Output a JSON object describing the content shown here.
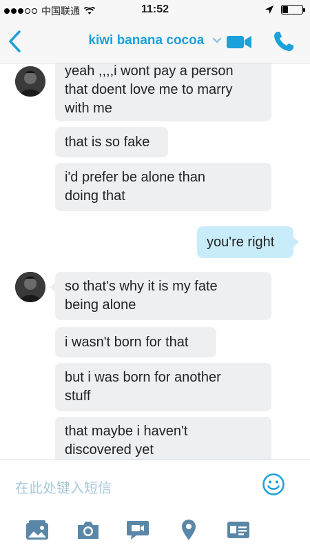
{
  "status": {
    "carrier": "中国联通",
    "time": "11:52",
    "battery_level": 0.3
  },
  "nav": {
    "contact_name": "kiwi banana cocoa",
    "icons": [
      "back-chevron-icon",
      "dropdown-chevron-icon",
      "video-call-icon",
      "phone-call-icon"
    ]
  },
  "messages": [
    {
      "direction": "in",
      "text_lines": [
        "yeah ,,,,i wont pay a person",
        "that doent love me to marry",
        "with me"
      ]
    },
    {
      "direction": "in",
      "text_lines": [
        "that is so fake"
      ]
    },
    {
      "direction": "in",
      "text_lines": [
        "i'd prefer be alone than",
        "doing that"
      ]
    },
    {
      "direction": "out",
      "text_lines": [
        "you're right"
      ]
    },
    {
      "direction": "in",
      "text_lines": [
        "so that's why it is my fate",
        "being alone"
      ]
    },
    {
      "direction": "in",
      "text_lines": [
        "i wasn't born for that"
      ]
    },
    {
      "direction": "in",
      "text_lines": [
        "but i was born for another",
        "stuff"
      ]
    },
    {
      "direction": "in",
      "text_lines": [
        "that maybe i haven't",
        "discovered yet"
      ]
    }
  ],
  "input": {
    "placeholder": "在此处键入短信"
  },
  "toolbar": {
    "icons": [
      "media-gallery-icon",
      "camera-icon",
      "video-message-icon",
      "location-pin-icon",
      "contact-card-icon"
    ]
  },
  "colors": {
    "accent": "#1ba1dc",
    "incoming_bubble": "#eeeff1",
    "outgoing_bubble": "#c9ecfb"
  }
}
